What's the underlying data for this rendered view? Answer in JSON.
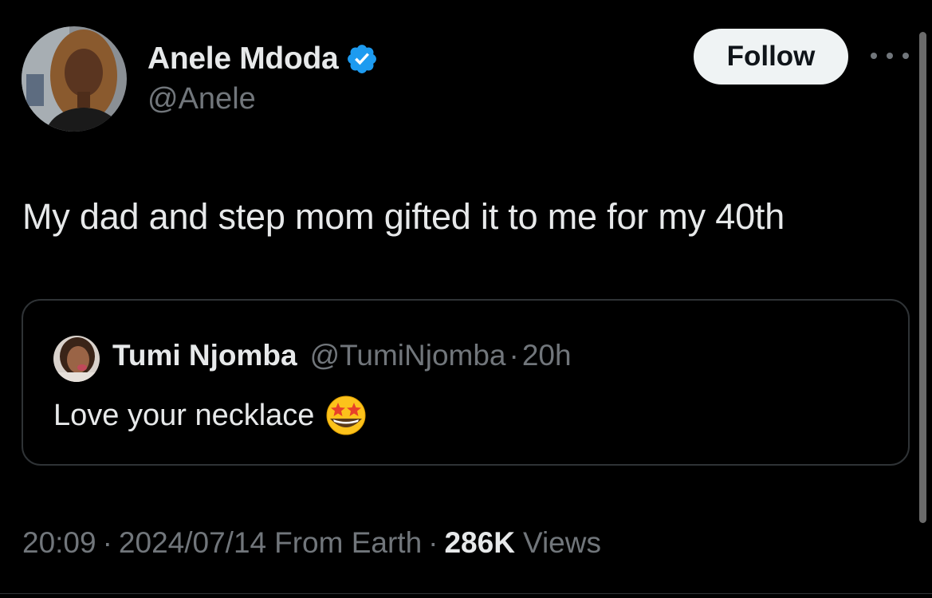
{
  "author": {
    "display_name": "Anele Mdoda",
    "handle": "@Anele",
    "verified": true,
    "verified_color": "#1d9bf0"
  },
  "actions": {
    "follow_label": "Follow",
    "more_icon": "more-horizontal-icon"
  },
  "tweet": {
    "text": "My dad and step mom gifted it to me for my 40th"
  },
  "quote": {
    "display_name": "Tumi Njomba",
    "handle": "@TumiNjomba",
    "separator": "·",
    "time": "20h",
    "text": "Love your necklace",
    "emoji_icon": "star-struck-emoji-icon"
  },
  "meta": {
    "time": "20:09",
    "separator": "·",
    "date": "2024/07/14",
    "location": "From Earth",
    "views_count": "286K",
    "views_label": "Views"
  },
  "colors": {
    "background": "#000000",
    "primary_text": "#e7e9ea",
    "secondary_text": "#71767b",
    "border": "#2f3336",
    "button_bg": "#eff3f4"
  }
}
